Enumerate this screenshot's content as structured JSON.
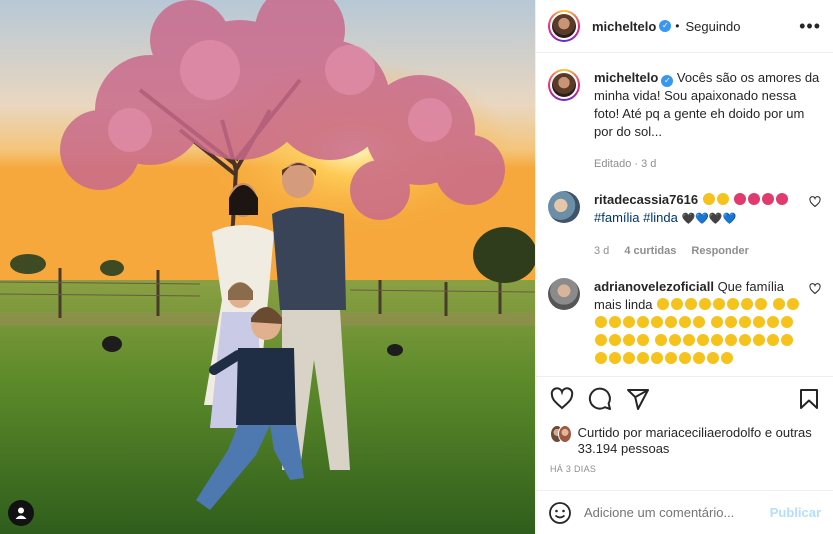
{
  "post": {
    "author": "micheltelo",
    "follow_status": "Seguindo",
    "more_label": "•••"
  },
  "caption": {
    "author": "micheltelo",
    "text": "Vocês são os amores da minha vida! Sou apaixonado nessa foto! Até pq a gente eh doido por um por do sol...",
    "edited": "Editado · 3 d"
  },
  "comments": [
    {
      "author": "ritadecassia7616",
      "hashtags": "#família #linda",
      "age": "3 d",
      "likes": "4 curtidas",
      "reply": "Responder"
    },
    {
      "author": "adrianovelezoficiall",
      "text": "Que família mais linda"
    }
  ],
  "likes": {
    "prefix": "Curtido por",
    "user": "mariaceciliaerodolfo",
    "suffix": "e outras 33.194 pessoas"
  },
  "time_ago": "HÁ 3 DIAS",
  "add_comment": {
    "placeholder": "Adicione um comentário...",
    "publish": "Publicar"
  },
  "icons": [
    "like-icon",
    "comment-icon",
    "share-icon",
    "save-icon",
    "emoji-icon",
    "tag-user-icon",
    "verified-icon",
    "more-icon"
  ],
  "colors": {
    "link": "#00376b",
    "verified": "#3897f0",
    "muted": "#8e8e8e",
    "publish": "#b2dffc"
  }
}
